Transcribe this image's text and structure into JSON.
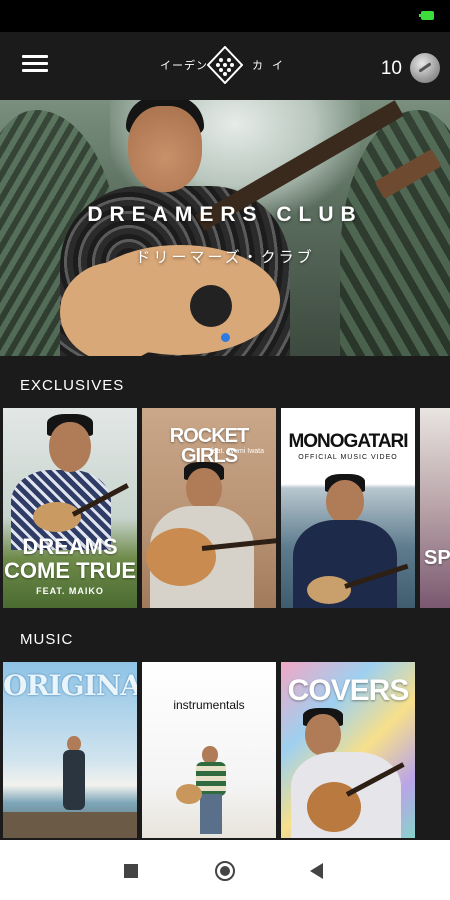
{
  "status_bar": {
    "battery_color": "#3ddc3d"
  },
  "header": {
    "logo_left": "イーデン",
    "logo_right": "カ イ",
    "points": "10",
    "menu_icon": "hamburger-menu-icon",
    "coin_icon": "coin-icon"
  },
  "hero": {
    "title": "DREAMERS CLUB",
    "subtitle": "ドリーマーズ・クラブ"
  },
  "exclusives": {
    "heading": "EXCLUSIVES",
    "cards": [
      {
        "title_line1": "DREAMS",
        "title_line2": "COME TRUE",
        "feat": "FEAT. MAIKO"
      },
      {
        "title": "ROCKET GIRLS",
        "feat": "feat. Ayumi Iwata"
      },
      {
        "title": "MONOGATARI",
        "subtitle": "OFFICIAL MUSIC VIDEO"
      },
      {
        "title": "SPI"
      }
    ]
  },
  "music": {
    "heading": "MUSIC",
    "cards": [
      {
        "title": "ORIGINALS"
      },
      {
        "title": "instrumentals"
      },
      {
        "title": "COVERS"
      }
    ]
  },
  "nav": {
    "recents_icon": "square-recents-icon",
    "home_icon": "circle-home-icon",
    "back_icon": "triangle-back-icon"
  },
  "colors": {
    "background": "#1b1b1b",
    "status_bar": "#000000",
    "nav_bar": "#ffffff",
    "accent_dot": "#2c7be5"
  }
}
